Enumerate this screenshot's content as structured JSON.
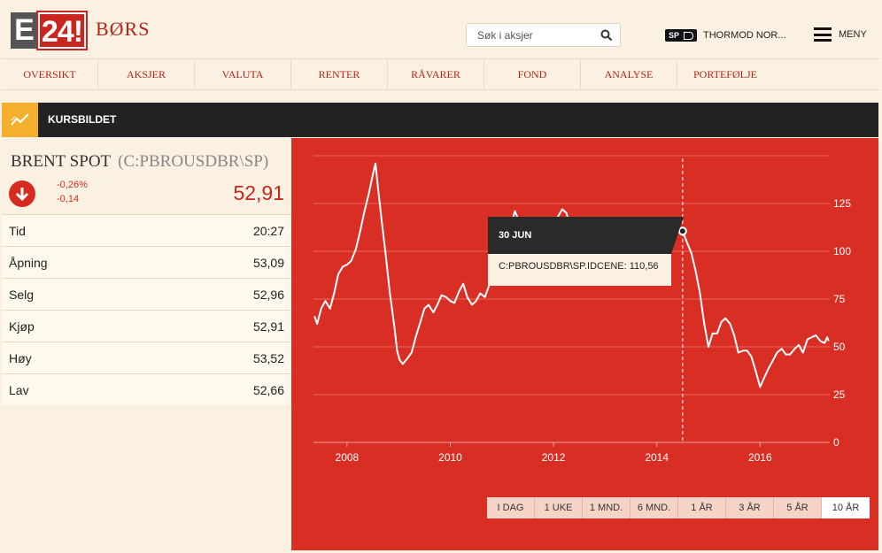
{
  "header": {
    "logo_e": "E",
    "logo_24": "24!",
    "brand": "BØRS",
    "search_placeholder": "Søk i aksjer",
    "sp_badge": "SP",
    "user_name": "THORMOD NOR...",
    "menu_label": "MENY"
  },
  "nav": [
    "OVERSIKT",
    "AKSJER",
    "VALUTA",
    "RENTER",
    "RÅVARER",
    "FOND",
    "ANALYSE",
    "PORTEFØLJE"
  ],
  "section": {
    "title": "KURSBILDET"
  },
  "instrument": {
    "name": "BRENT SPOT",
    "code": "(C:PBROUSDBR\\SP)",
    "change_pct": "-0,26%",
    "change_abs": "-0,14",
    "last": "52,91"
  },
  "stats": [
    {
      "label": "Tid",
      "value": "20:27"
    },
    {
      "label": "Åpning",
      "value": "53,09"
    },
    {
      "label": "Selg",
      "value": "52,96"
    },
    {
      "label": "Kjøp",
      "value": "52,91"
    },
    {
      "label": "Høy",
      "value": "53,52"
    },
    {
      "label": "Lav",
      "value": "52,66"
    }
  ],
  "tooltip": {
    "date": "30 JUN",
    "text": "C:PBROUSDBR\\SP.IDCENE: 110,56"
  },
  "ranges": {
    "buttons": [
      "I DAG",
      "1 UKE",
      "1 MND.",
      "6 MND.",
      "1 ÅR",
      "3 ÅR",
      "5 ÅR",
      "10 ÅR"
    ],
    "active": "10 ÅR"
  },
  "colors": {
    "brand_red": "#c8261f",
    "chart_bg": "#d82e24",
    "accent": "#f4b02c"
  },
  "chart_data": {
    "type": "line",
    "y_ticks": [
      0,
      25,
      50,
      75,
      100,
      125
    ],
    "x_ticks": [
      2008,
      2010,
      2012,
      2014,
      2016
    ],
    "xlim": [
      2007.35,
      2017.35
    ],
    "ylim": [
      0,
      150
    ],
    "grid": true,
    "highlight": {
      "x": 2014.5,
      "y": 110.56
    },
    "series": [
      {
        "points": [
          [
            2007.37,
            66
          ],
          [
            2007.42,
            62
          ],
          [
            2007.5,
            70
          ],
          [
            2007.58,
            74
          ],
          [
            2007.67,
            70
          ],
          [
            2007.75,
            78
          ],
          [
            2007.83,
            88
          ],
          [
            2007.92,
            92
          ],
          [
            2008.0,
            93
          ],
          [
            2008.08,
            95
          ],
          [
            2008.17,
            101
          ],
          [
            2008.25,
            110
          ],
          [
            2008.33,
            120
          ],
          [
            2008.42,
            130
          ],
          [
            2008.5,
            140
          ],
          [
            2008.55,
            146
          ],
          [
            2008.6,
            133
          ],
          [
            2008.67,
            116
          ],
          [
            2008.75,
            98
          ],
          [
            2008.83,
            78
          ],
          [
            2008.92,
            60
          ],
          [
            2008.97,
            48
          ],
          [
            2009.02,
            43
          ],
          [
            2009.08,
            41
          ],
          [
            2009.17,
            44
          ],
          [
            2009.25,
            47
          ],
          [
            2009.33,
            55
          ],
          [
            2009.42,
            63
          ],
          [
            2009.5,
            70
          ],
          [
            2009.58,
            72
          ],
          [
            2009.67,
            68
          ],
          [
            2009.75,
            72
          ],
          [
            2009.83,
            77
          ],
          [
            2009.92,
            76
          ],
          [
            2010.0,
            74
          ],
          [
            2010.08,
            73
          ],
          [
            2010.17,
            79
          ],
          [
            2010.25,
            83
          ],
          [
            2010.33,
            76
          ],
          [
            2010.42,
            72
          ],
          [
            2010.5,
            74
          ],
          [
            2010.58,
            78
          ],
          [
            2010.67,
            76
          ],
          [
            2010.75,
            82
          ],
          [
            2010.83,
            87
          ],
          [
            2010.92,
            93
          ],
          [
            2011.0,
            97
          ],
          [
            2011.08,
            103
          ],
          [
            2011.17,
            113
          ],
          [
            2011.25,
            121
          ],
          [
            2011.33,
            116
          ],
          [
            2011.42,
            113
          ],
          [
            2011.5,
            115
          ],
          [
            2011.58,
            110
          ],
          [
            2011.67,
            112
          ],
          [
            2011.75,
            108
          ],
          [
            2011.83,
            110
          ],
          [
            2011.92,
            107
          ],
          [
            2012.0,
            111
          ],
          [
            2012.08,
            118
          ],
          [
            2012.17,
            122
          ],
          [
            2012.25,
            120
          ],
          [
            2012.33,
            112
          ],
          [
            2012.42,
            100
          ],
          [
            2012.5,
            97
          ],
          [
            2012.58,
            107
          ],
          [
            2012.67,
            113
          ],
          [
            2012.75,
            110
          ],
          [
            2012.83,
            108
          ],
          [
            2012.92,
            111
          ],
          [
            2013.0,
            113
          ],
          [
            2013.08,
            115
          ],
          [
            2013.17,
            110
          ],
          [
            2013.25,
            103
          ],
          [
            2013.33,
            103
          ],
          [
            2013.42,
            104
          ],
          [
            2013.5,
            106
          ],
          [
            2013.58,
            110
          ],
          [
            2013.67,
            113
          ],
          [
            2013.75,
            109
          ],
          [
            2013.83,
            106
          ],
          [
            2013.92,
            110
          ],
          [
            2014.0,
            108
          ],
          [
            2014.08,
            109
          ],
          [
            2014.17,
            108
          ],
          [
            2014.25,
            107
          ],
          [
            2014.33,
            109
          ],
          [
            2014.42,
            111
          ],
          [
            2014.5,
            110.5
          ],
          [
            2014.58,
            105
          ],
          [
            2014.67,
            99
          ],
          [
            2014.75,
            90
          ],
          [
            2014.83,
            79
          ],
          [
            2014.92,
            62
          ],
          [
            2015.0,
            50
          ],
          [
            2015.08,
            57
          ],
          [
            2015.17,
            57
          ],
          [
            2015.25,
            63
          ],
          [
            2015.33,
            65
          ],
          [
            2015.42,
            62
          ],
          [
            2015.5,
            56
          ],
          [
            2015.58,
            47
          ],
          [
            2015.67,
            48
          ],
          [
            2015.75,
            48
          ],
          [
            2015.83,
            45
          ],
          [
            2015.92,
            37
          ],
          [
            2016.0,
            29
          ],
          [
            2016.05,
            32
          ],
          [
            2016.1,
            35
          ],
          [
            2016.17,
            39
          ],
          [
            2016.25,
            43
          ],
          [
            2016.33,
            47
          ],
          [
            2016.42,
            49
          ],
          [
            2016.5,
            46
          ],
          [
            2016.58,
            46
          ],
          [
            2016.67,
            49
          ],
          [
            2016.75,
            51
          ],
          [
            2016.83,
            47
          ],
          [
            2016.92,
            54
          ],
          [
            2017.0,
            55
          ],
          [
            2017.08,
            56
          ],
          [
            2017.17,
            53
          ],
          [
            2017.25,
            52
          ],
          [
            2017.3,
            55
          ],
          [
            2017.33,
            53
          ]
        ]
      }
    ]
  }
}
